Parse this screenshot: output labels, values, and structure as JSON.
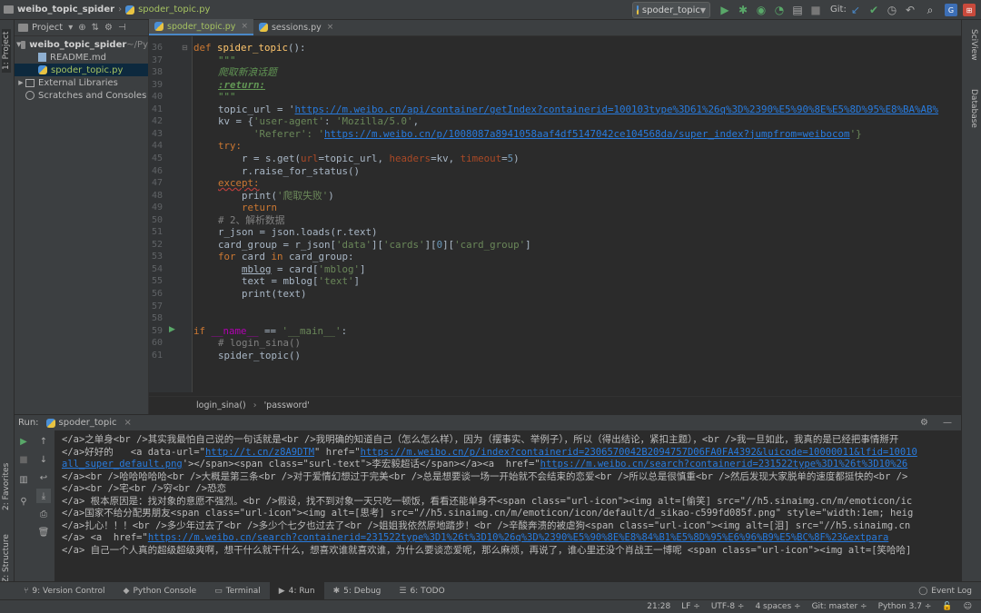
{
  "navbar": {
    "project": "weibo_topic_spider",
    "file": "spoder_topic.py",
    "run_config": "spoder_topic",
    "git_label": "Git:"
  },
  "sidebar": {
    "project_tab": "1: Project",
    "favorites_tab": "2: Favorites",
    "structure_tab": "Z: Structure",
    "sciview_tab": "SciView",
    "database_tab": "Database"
  },
  "project_panel": {
    "title": "Project",
    "tree": [
      {
        "label": "weibo_topic_spider",
        "suffix": " ~/Py"
      },
      {
        "label": "README.md"
      },
      {
        "label": "spoder_topic.py"
      },
      {
        "label": "External Libraries"
      },
      {
        "label": "Scratches and Consoles"
      }
    ]
  },
  "editor": {
    "tabs": [
      {
        "label": "spoder_topic.py"
      },
      {
        "label": "sessions.py"
      }
    ],
    "line_numbers": [
      "36",
      "37",
      "38",
      "39",
      "40",
      "41",
      "42",
      "43",
      "44",
      "45",
      "46",
      "47",
      "48",
      "49",
      "50",
      "51",
      "52",
      "53",
      "54",
      "55",
      "56",
      "57",
      "58",
      "59",
      "60",
      "61"
    ],
    "code": {
      "l36_kw": "def ",
      "l36_fn": "spider_topic",
      "l36_end": "():",
      "l37": "\"\"\"",
      "l38": "爬取新浪话题",
      "l39": ":return:",
      "l40": "\"\"\"",
      "l41_a": "topic_url = '",
      "l41_url": "https://m.weibo.cn/api/container/getIndex?containerid=100103type%3D61%26q%3D%2390%E5%90%8E%E5%8D%95%E8%BA%AB%",
      "l42_a": "kv = {",
      "l42_k1": "'user-agent'",
      "l42_b": ": ",
      "l42_v1": "'Mozilla/5.0'",
      "l42_c": ",",
      "l43_k2": "'Referer'",
      "l43_b": ": '",
      "l43_url": "https://m.weibo.cn/p/1008087a8941058aaf4df5147042ce104568da/super_index?jumpfrom=weibocom",
      "l43_c": "'}",
      "l44": "try:",
      "l45_a": "r = s.get(",
      "l45_p1": "url",
      "l45_b": "=topic_url, ",
      "l45_p2": "headers",
      "l45_c": "=kv, ",
      "l45_p3": "timeout",
      "l45_d": "=",
      "l45_n": "5",
      "l45_e": ")",
      "l46": "r.raise_for_status()",
      "l47": "except:",
      "l48_a": "print(",
      "l48_s": "'爬取失败'",
      "l48_b": ")",
      "l49": "return",
      "l50": "# 2、解析数据",
      "l51": "r_json = json.loads(r.text)",
      "l52_a": "card_group = r_json[",
      "l52_s1": "'data'",
      "l52_b": "][",
      "l52_s2": "'cards'",
      "l52_c": "][",
      "l52_n": "0",
      "l52_d": "][",
      "l52_s3": "'card_group'",
      "l52_e": "]",
      "l53_kw1": "for ",
      "l53_a": "card ",
      "l53_kw2": "in ",
      "l53_b": "card_group:",
      "l54_a": "mblog",
      "l54_b": " = card[",
      "l54_s": "'mblog'",
      "l54_c": "]",
      "l55_a": "text = mblog[",
      "l55_s": "'text'",
      "l55_b": "]",
      "l56": "print(text)",
      "l59_kw": "if ",
      "l59_d": "__name__",
      "l59_a": " == ",
      "l59_s": "'__main__'",
      "l59_b": ":",
      "l60": "# login_sina()",
      "l61": "spider_topic()"
    },
    "breadcrumb": [
      "login_sina()",
      "'password'"
    ]
  },
  "run_panel": {
    "label": "Run:",
    "config": "spoder_topic",
    "lines": [
      {
        "text": "</a>之单身<br />其实我最怕自己说的一句话就是<br />我明确的知道自己（怎么怎么样），因为（摆事实、举例子），所以（得出结论，紧扣主题），<br />我一旦如此，我真的是已经把事情掰开"
      },
      {
        "a": "</a>好好的   <a data-url=\"",
        "link1": "http://t.cn/z8A9DTM",
        "b": "\" href=\"",
        "link2": "https://m.weibo.cn/p/index?containerid=2306570042B2094757D06FA0FA4392&luicode=10000011&lfid=10010"
      },
      {
        "a": "",
        "link1": "all_super_default.png",
        "b": "'></span><span class=\"surl-text\">李宏毅超话</span></a><a  href=\"",
        "link2": "https://m.weibo.cn/search?containerid=231522type%3D1%26t%3D10%26"
      },
      {
        "text": "</a><br />哈哈哈哈哈<br />大概是第三条<br />对于爱情幻想过于完美<br />总是想要谈一场一开始就不会结束的恋爱<br />所以总是很慎重<br />然后发现大家脱单的速度都挺快的<br />"
      },
      {
        "text": "</a><br />宅<br />穷<br />恐恋"
      },
      {
        "text": "</a> 根本原因是：找对象的意愿不强烈。<br />假设，找不到对象一天只吃一顿饭，看看还能单身不<span class=\"url-icon\"><img alt=[偷笑] src=\"//h5.sinaimg.cn/m/emoticon/ic"
      },
      {
        "text": "</a>国家不给分配男朋友<span class=\"url-icon\"><img alt=[思考] src=\"//h5.sinaimg.cn/m/emoticon/icon/default/d_sikao-c599fd085f.png\" style=\"width:1em; heig"
      },
      {
        "text": "</a>扎心！！！<br />多少年过去了<br />多少个七夕也过去了<br />姐姐我依然原地踏步！<br />辛酸奔溃的被虐狗<span class=\"url-icon\"><img alt=[泪] src=\"//h5.sinaimg.cn"
      },
      {
        "a": "</a> <a  href=\"",
        "link1": "https://m.weibo.cn/search?containerid=231522type%3D1%26t%3D10%26q%3D%2390%E5%90%8E%E8%84%B1%E5%8D%95%E6%96%B9%E5%BC%8F%23&extpara",
        "b": "",
        "link2": ""
      },
      {
        "text": "</a> 自己一个人真的超级超级爽啊，想干什么就干什么，想喜欢谁就喜欢谁，为什么要谈恋爱呢，那么麻烦，再说了，谁心里还没个肖战王一博呢 <span class=\"url-icon\"><img alt=[笑哈哈]"
      }
    ]
  },
  "toolwindows": [
    {
      "label": "9: Version Control"
    },
    {
      "label": "Python Console"
    },
    {
      "label": "Terminal"
    },
    {
      "label": "4: Run"
    },
    {
      "label": "5: Debug"
    },
    {
      "label": "6: TODO"
    }
  ],
  "event_log": "Event Log",
  "status": {
    "position": "21:28",
    "line_sep": "LF ÷",
    "encoding": "UTF-8 ÷",
    "indent": "4 spaces ÷",
    "git": "Git: master ÷",
    "python": "Python 3.7 ÷"
  }
}
